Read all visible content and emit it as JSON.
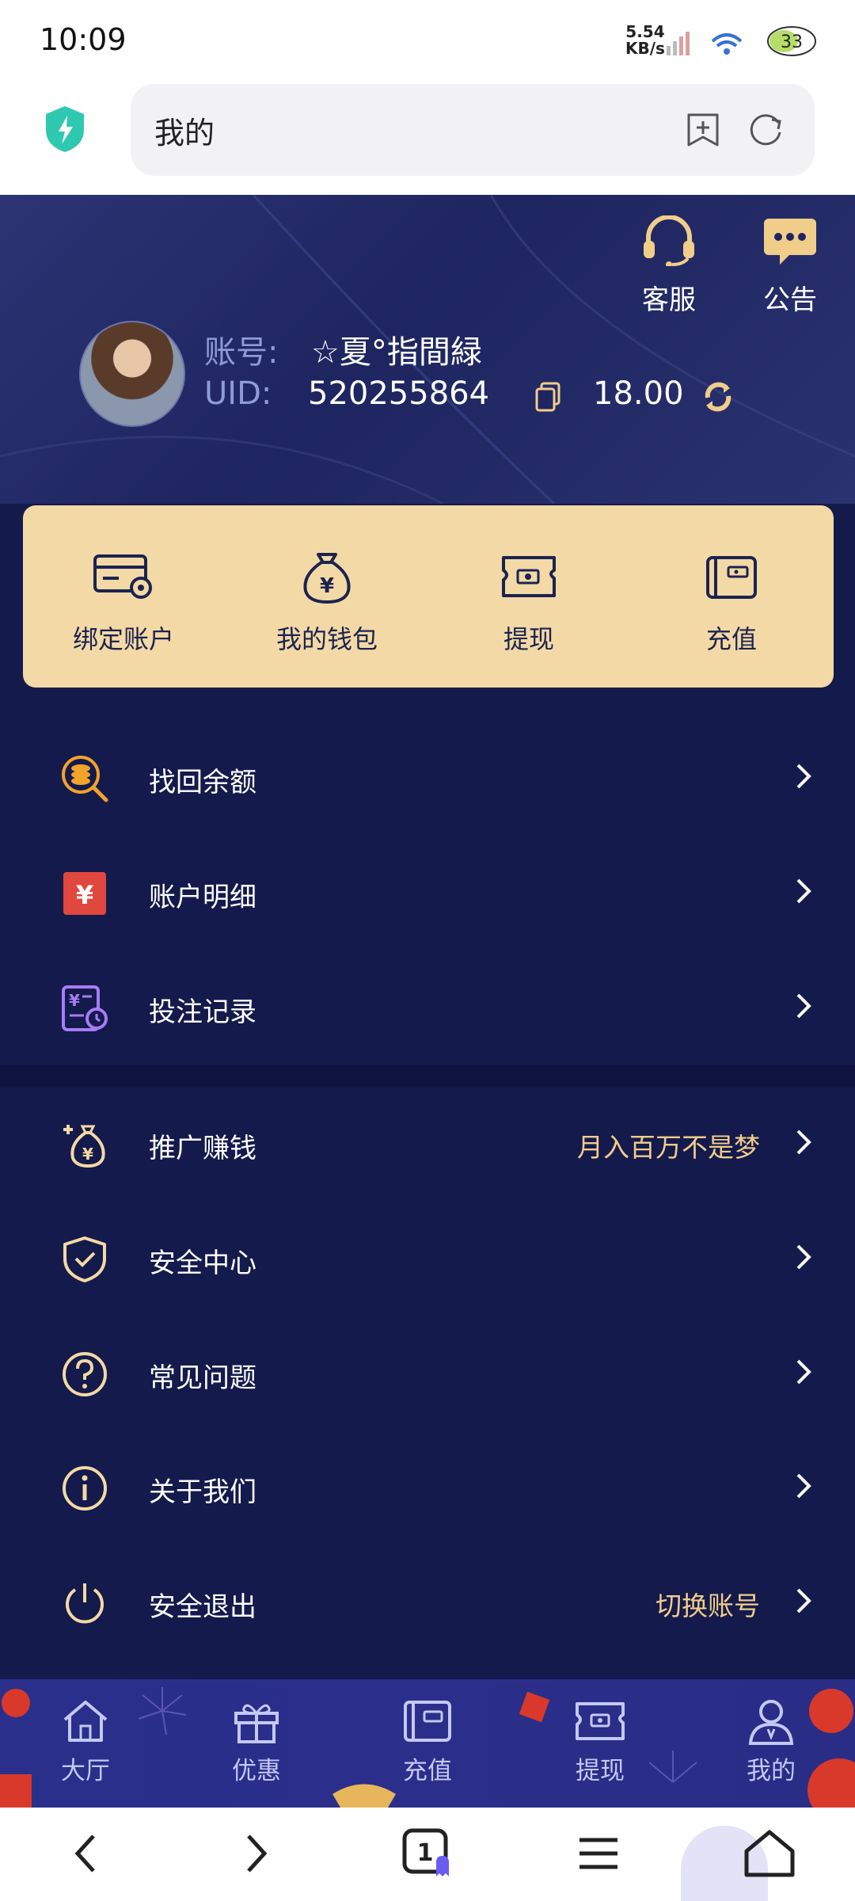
{
  "status_bar": {
    "time": "10:09",
    "net_speed_value": "5.54",
    "net_speed_unit": "KB/s",
    "battery": "33"
  },
  "browser": {
    "url_text": "我的"
  },
  "header": {
    "customer_service": "客服",
    "announcement": "公告",
    "account_label": "账号:",
    "account_value": "☆夏°指間緑",
    "uid_label": "UID:",
    "uid_value": "520255864",
    "balance": "18.00"
  },
  "quick_actions": [
    {
      "label": "绑定账户",
      "icon": "card-settings-icon"
    },
    {
      "label": "我的钱包",
      "icon": "money-bag-icon"
    },
    {
      "label": "提现",
      "icon": "withdraw-ticket-icon"
    },
    {
      "label": "充值",
      "icon": "wallet-icon"
    }
  ],
  "menu_group_1": [
    {
      "label": "找回余额",
      "icon": "coin-search-icon"
    },
    {
      "label": "账户明细",
      "icon": "yuan-document-icon"
    },
    {
      "label": "投注记录",
      "icon": "bet-record-icon"
    }
  ],
  "menu_group_2": [
    {
      "label": "推广赚钱",
      "right": "月入百万不是梦",
      "icon": "promo-money-icon"
    },
    {
      "label": "安全中心",
      "right": "",
      "icon": "shield-check-icon"
    },
    {
      "label": "常见问题",
      "right": "",
      "icon": "question-icon"
    },
    {
      "label": "关于我们",
      "right": "",
      "icon": "info-icon"
    },
    {
      "label": "安全退出",
      "right": "切换账号",
      "icon": "power-icon"
    }
  ],
  "tab_bar": [
    {
      "label": "大厅",
      "icon": "home-icon"
    },
    {
      "label": "优惠",
      "icon": "gift-icon"
    },
    {
      "label": "充值",
      "icon": "wallet-icon"
    },
    {
      "label": "提现",
      "icon": "withdraw-icon"
    },
    {
      "label": "我的",
      "icon": "user-icon"
    }
  ],
  "browser_nav": {
    "tab_count": "1"
  },
  "colors": {
    "background": "#141a4c",
    "gold_card": "#f3d9a5",
    "accent_gold": "#f1cd8a",
    "tab_bar": "#2a2f8c"
  }
}
